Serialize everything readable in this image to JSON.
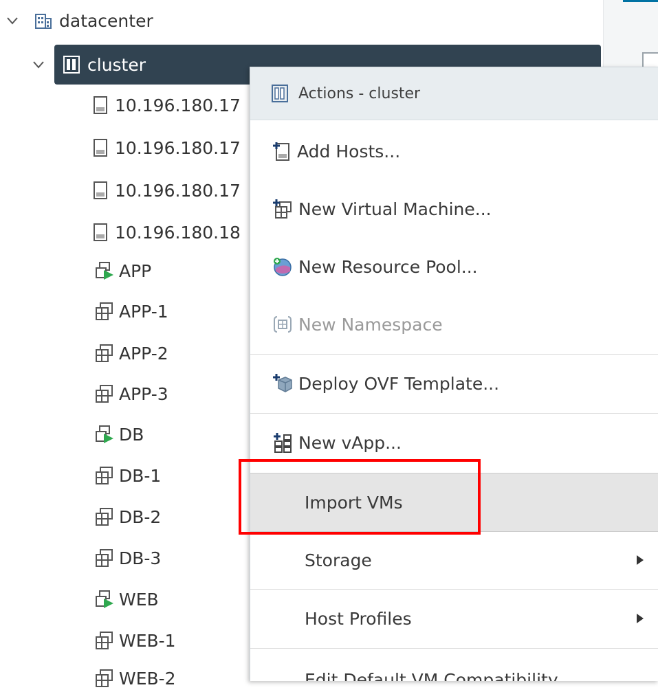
{
  "tree": {
    "datacenter": {
      "label": "datacenter",
      "icon": "datacenter-icon"
    },
    "cluster": {
      "label": "cluster",
      "icon": "cluster-icon",
      "selected": true
    },
    "children": [
      {
        "label": "10.196.180.17",
        "icon": "host-icon"
      },
      {
        "label": "10.196.180.17",
        "icon": "host-icon"
      },
      {
        "label": "10.196.180.17",
        "icon": "host-icon"
      },
      {
        "label": "10.196.180.18",
        "icon": "host-icon"
      },
      {
        "label": "APP",
        "icon": "vapp-running-icon"
      },
      {
        "label": "APP-1",
        "icon": "vm-icon"
      },
      {
        "label": "APP-2",
        "icon": "vm-icon"
      },
      {
        "label": "APP-3",
        "icon": "vm-icon"
      },
      {
        "label": "DB",
        "icon": "vapp-running-icon"
      },
      {
        "label": "DB-1",
        "icon": "vm-icon"
      },
      {
        "label": "DB-2",
        "icon": "vm-icon"
      },
      {
        "label": "DB-3",
        "icon": "vm-icon"
      },
      {
        "label": "WEB",
        "icon": "vapp-running-icon"
      },
      {
        "label": "WEB-1",
        "icon": "vm-icon"
      },
      {
        "label": "WEB-2",
        "icon": "vm-icon"
      }
    ]
  },
  "menu": {
    "header": "Actions - cluster",
    "items": [
      {
        "label": "Add Hosts...",
        "icon": "add-host-icon"
      },
      {
        "label": "New Virtual Machine...",
        "icon": "new-vm-icon"
      },
      {
        "label": "New Resource Pool...",
        "icon": "new-resource-pool-icon"
      },
      {
        "label": "New Namespace",
        "icon": "namespace-icon",
        "disabled": true
      },
      {
        "label": "Deploy OVF Template...",
        "icon": "deploy-ovf-icon"
      },
      {
        "label": "New vApp...",
        "icon": "new-vapp-icon"
      },
      {
        "label": "Import VMs",
        "highlighted": true
      },
      {
        "label": "Storage",
        "submenu": true
      },
      {
        "label": "Host Profiles",
        "submenu": true
      },
      {
        "label": "Edit Default VM Compatibility"
      }
    ]
  },
  "colors": {
    "selection_bg": "#314351",
    "menu_header_bg": "#e8edf0",
    "highlight_bg": "#e5e5e5",
    "callout": "#ff0000"
  }
}
